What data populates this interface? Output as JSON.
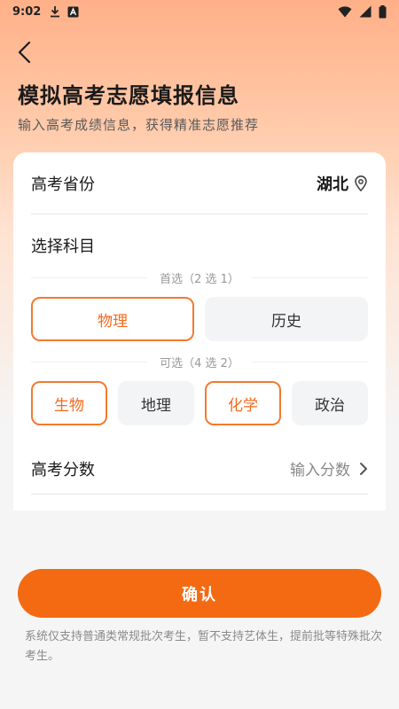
{
  "status_bar": {
    "time": "9:02"
  },
  "header": {
    "title": "模拟高考志愿填报信息",
    "subtitle": "输入高考成绩信息，获得精准志愿推荐"
  },
  "form": {
    "province_label": "高考省份",
    "province_value": "湖北",
    "subjects_title": "选择科目",
    "primary_label": "首选（2 选 1）",
    "primary_options": [
      "物理",
      "历史"
    ],
    "secondary_label": "可选（4 选 2）",
    "secondary_options": [
      "生物",
      "地理",
      "化学",
      "政治"
    ],
    "score_label": "高考分数",
    "score_placeholder": "输入分数"
  },
  "footer": {
    "confirm_label": "确认",
    "disclaimer": "系统仅支持普通类常规批次考生，暂不支持艺体生，提前批等特殊批次考生。"
  },
  "colors": {
    "accent": "#f46a12",
    "selected_border": "#f47a2e"
  },
  "icons": {
    "download": "download-icon",
    "app": "app-notification-icon",
    "wifi": "wifi-icon",
    "signal": "signal-icon",
    "battery": "battery-icon",
    "back": "chevron-left-icon",
    "location": "location-pin-icon",
    "arrow": "chevron-right-icon"
  }
}
